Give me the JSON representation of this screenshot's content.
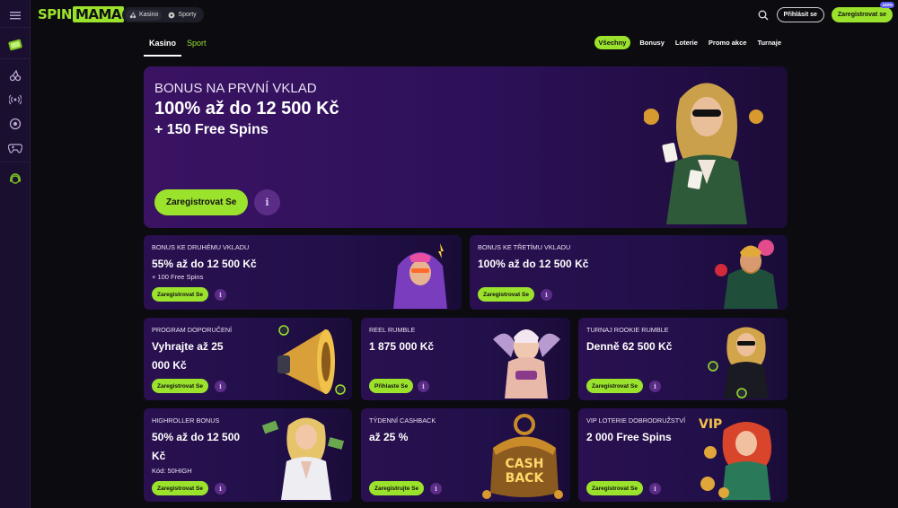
{
  "topbar": {
    "logo_spin": "SPIN",
    "logo_mama": "MAMA",
    "switch": [
      {
        "label": "Kasino",
        "icon": "cherries-icon"
      },
      {
        "label": "Sporty",
        "icon": "ball-icon"
      }
    ],
    "login_label": "Přihlásit se",
    "register_label": "Zaregistrovat se",
    "register_badge": "100%"
  },
  "sidebar": {
    "icons": [
      "menu-icon",
      "wallet-bonus-icon",
      "cherries-icon",
      "live-icon",
      "soccer-icon",
      "gamepad-icon",
      "support-icon"
    ]
  },
  "tabs": [
    {
      "label": "Kasino"
    },
    {
      "label": "Sport"
    }
  ],
  "filters": [
    {
      "label": "Všechny"
    },
    {
      "label": "Bonusy"
    },
    {
      "label": "Loterie"
    },
    {
      "label": "Promo akce"
    },
    {
      "label": "Turnaje"
    }
  ],
  "hero": {
    "subtitle": "BONUS NA PRVNÍ VKLAD",
    "title": "100% až do 12 500 Kč",
    "spins": "+ 150 Free Spins",
    "cta": "Zaregistrovat Se",
    "info": "i"
  },
  "cards": [
    {
      "subtitle": "BONUS KE DRUHÉMU VKLADU",
      "title": "55% až do 12 500 Kč",
      "extra": "+ 100 Free Spins",
      "cta": "Zaregistrovat Se"
    },
    {
      "subtitle": "BONUS KE TŘETÍMU VKLADU",
      "title": "100% až do 12 500 Kč",
      "cta": "Zaregistrovat Se"
    },
    {
      "subtitle": "PROGRAM DOPORUČENÍ",
      "title_line1": "Vyhrajte až 25",
      "title_line2": "000 Kč",
      "cta": "Zaregistrovat Se"
    },
    {
      "subtitle": "REEL RUMBLE",
      "title": "1 875 000 Kč",
      "cta": "Přihlaste Se"
    },
    {
      "subtitle": "TURNAJ ROOKIE RUMBLE",
      "title": "Denně 62 500 Kč",
      "cta": "Zaregistrovat Se"
    },
    {
      "subtitle": "HIGHROLLER BONUS",
      "title_line1": "50% až do 12 500",
      "title_line2": "Kč",
      "extra": "Kód: 50HIGH",
      "cta": "Zaregistrovat Se"
    },
    {
      "subtitle": "TÝDENNÍ CASHBACK",
      "title": "až 25 %",
      "cta": "Zaregistrujte Se",
      "art_text_1": "CASH",
      "art_text_2": "BACK"
    },
    {
      "subtitle": "VIP LOTERIE DOBRODRUŽSTVÍ",
      "title": "2 000 Free Spins",
      "cta": "Zaregistrovat Se",
      "art_text": "VIP"
    }
  ],
  "colors": {
    "accent": "#9be22d",
    "panel": "#2a1050",
    "background": "#0b0b10"
  }
}
